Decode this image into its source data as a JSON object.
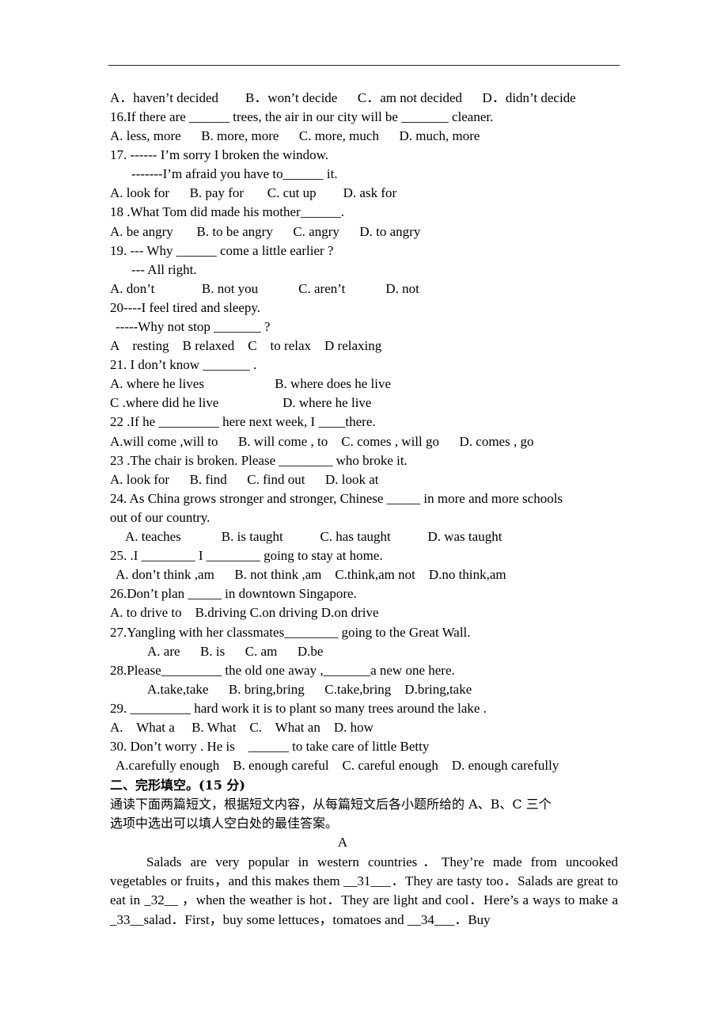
{
  "header": {
    "divider": true
  },
  "questions": [
    {
      "id": "q15-options",
      "lines": [
        "A．haven’t decided        B．won’t decide      C．am not decided      D．didn’t decide"
      ]
    },
    {
      "id": "q16",
      "stem": "16.If there are ______ trees, the air in our city will be _______ cleaner.",
      "options": "A. less, more      B. more, more      C. more, much      D. much, more"
    },
    {
      "id": "q17",
      "stem": "17. ------ I’m sorry I broken the window.",
      "stem2": "-------I’m afraid you have to______ it.",
      "options": "A. look for      B. pay for       C. cut up        D. ask for"
    },
    {
      "id": "q18",
      "stem": "18 .What Tom did made his mother______.",
      "options": "A. be angry       B. to be angry      C. angry      D. to angry"
    },
    {
      "id": "q19",
      "stem": "19. --- Why ______ come a little earlier ?",
      "stem2": "--- All right.",
      "options": "A. don’t              B. not you            C. aren’t            D. not"
    },
    {
      "id": "q20",
      "stem": "20----I feel tired and sleepy.",
      "stem2": "-----Why not stop _______ ?",
      "options": "A    resting    B relaxed    C    to relax    D relaxing"
    },
    {
      "id": "q21",
      "stem": "21. I don’t know _______ .",
      "options": "A. where he lives                     B. where does he live",
      "options2": "C .where did he live                   D. where he live"
    },
    {
      "id": "q22",
      "stem": "22 .If he _________ here next week, I ____there.",
      "options": "A.will come ,will to      B. will come , to    C. comes , will go      D. comes , go"
    },
    {
      "id": "q23",
      "stem": "23 .The chair is broken. Please ________ who broke it.",
      "options": "A. look for      B. find      C. find out      D. look at"
    },
    {
      "id": "q24",
      "stem": "24. As China grows stronger and stronger, Chinese _____ in more and more schools",
      "stem2": "out of our country.",
      "options": "A. teaches            B. is taught           C. has taught           D. was taught"
    },
    {
      "id": "q25",
      "stem": "25. .I ________ I ________ going to stay at home.",
      "options": "A. don’t think ,am      B. not think ,am    C.think,am not    D.no think,am"
    },
    {
      "id": "q26",
      "stem": "26.Don’t plan _____ in downtown Singapore.",
      "options": "A. to drive to    B.driving C.on driving D.on drive"
    },
    {
      "id": "q27",
      "stem": "27.Yangling with her classmates________ going to the Great Wall.",
      "options": "A. are      B. is      C. am      D.be"
    },
    {
      "id": "q28",
      "stem": "28.Please_________ the old one away ,_______a new one here.",
      "options": "A.take,take      B. bring,bring      C.take,bring    D.bring,take"
    },
    {
      "id": "q29",
      "stem": "29. _________ hard work it is to plant so many trees around the lake .",
      "options": "A.    What a     B. What    C.    What an    D. how"
    },
    {
      "id": "q30",
      "stem": "30. Don’t worry . He is    ______ to take care of little Betty",
      "options": "A.carefully enough    B. enough careful    C. careful enough    D. enough carefully"
    }
  ],
  "section2": {
    "heading": "二、完形填空。(15 分)",
    "instruction_line1": "通读下面两篇短文，根据短文内容，从每篇短文后各小题所给的 A、B、C 三个",
    "instruction_line2": "选项中选出可以填人空白处的最佳答案。",
    "passage_label": "A",
    "passage_text": "Salads are very popular in western countries．They’re made from uncooked vegetables or fruits，and this makes them __31___．They are tasty too．Salads are great to eat in   _32__  ，when the weather is hot．They are light and cool．Here’s a ways to make a _33__salad．First，buy some lettuces，tomatoes and __34___．Buy"
  }
}
